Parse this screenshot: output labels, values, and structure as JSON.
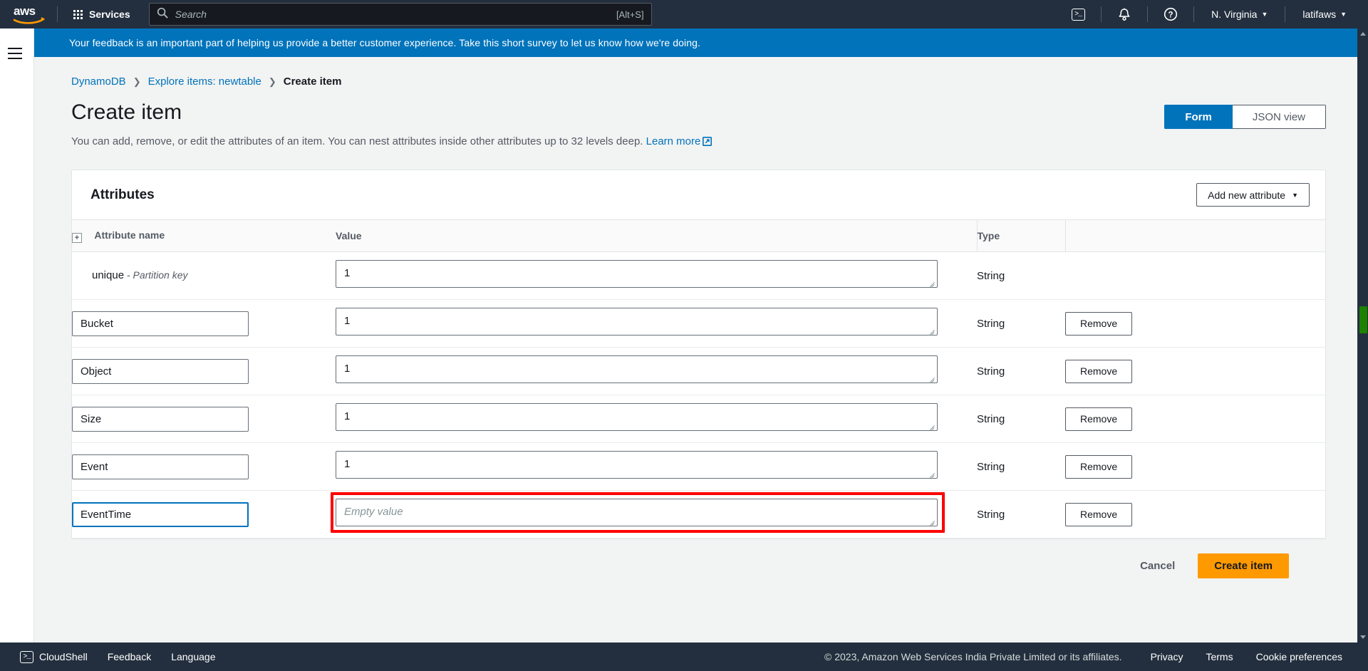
{
  "topnav": {
    "logo_alt": "aws-logo",
    "services_label": "Services",
    "search": {
      "placeholder": "Search",
      "shortcut": "[Alt+S]"
    },
    "cloudshell_glyph": ">_",
    "region_label": "N. Virginia",
    "account_label": "latifaws",
    "caret": "▼"
  },
  "banner": {
    "text": "Your feedback is an important part of helping us provide a better customer experience. Take this short survey to let us know how we're doing.",
    "color": "#0073bb"
  },
  "breadcrumb": {
    "items": [
      {
        "label": "DynamoDB",
        "current": false
      },
      {
        "label": "Explore items: newtable",
        "current": false
      },
      {
        "label": "Create item",
        "current": true
      }
    ],
    "separator": "❯"
  },
  "page": {
    "title": "Create item",
    "description": "You can add, remove, or edit the attributes of an item. You can nest attributes inside other attributes up to 32 levels deep.",
    "learn_more": "Learn more"
  },
  "view_toggle": {
    "options": [
      {
        "label": "Form",
        "selected": true
      },
      {
        "label": "JSON view",
        "selected": false
      }
    ],
    "active_color": "#0073bb"
  },
  "panel": {
    "heading": "Attributes",
    "add_attribute_label": "Add new attribute",
    "add_attribute_caret": "▼",
    "expand_icon_glyph": "+",
    "columns": [
      "Attribute name",
      "Value",
      "Type"
    ],
    "remove_label": "Remove",
    "rows": [
      {
        "name": "unique",
        "name_suffix": "- Partition key",
        "is_key": true,
        "value": "1",
        "placeholder": "",
        "type": "String",
        "removable": false,
        "name_focused": false,
        "value_highlighted": false
      },
      {
        "name": "Bucket",
        "name_suffix": "",
        "is_key": false,
        "value": "1",
        "placeholder": "",
        "type": "String",
        "removable": true,
        "name_focused": false,
        "value_highlighted": false
      },
      {
        "name": "Object",
        "name_suffix": "",
        "is_key": false,
        "value": "1",
        "placeholder": "",
        "type": "String",
        "removable": true,
        "name_focused": false,
        "value_highlighted": false
      },
      {
        "name": "Size",
        "name_suffix": "",
        "is_key": false,
        "value": "1",
        "placeholder": "",
        "type": "String",
        "removable": true,
        "name_focused": false,
        "value_highlighted": false
      },
      {
        "name": "Event",
        "name_suffix": "",
        "is_key": false,
        "value": "1",
        "placeholder": "",
        "type": "String",
        "removable": true,
        "name_focused": false,
        "value_highlighted": false
      },
      {
        "name": "EventTime",
        "name_suffix": "",
        "is_key": false,
        "value": "",
        "placeholder": "Empty value",
        "type": "String",
        "removable": true,
        "name_focused": true,
        "value_highlighted": true
      }
    ],
    "highlight_color": "#ff0000"
  },
  "actions": {
    "cancel_label": "Cancel",
    "submit_label": "Create item",
    "submit_color": "#ff9900"
  },
  "bottombar": {
    "cloudshell_label": "CloudShell",
    "cloudshell_glyph": ">_",
    "feedback_label": "Feedback",
    "language_label": "Language",
    "copyright": "© 2023, Amazon Web Services India Private Limited or its affiliates.",
    "links": [
      "Privacy",
      "Terms",
      "Cookie preferences"
    ]
  },
  "scrollbar": {
    "thumb_color": "#1d8102"
  }
}
